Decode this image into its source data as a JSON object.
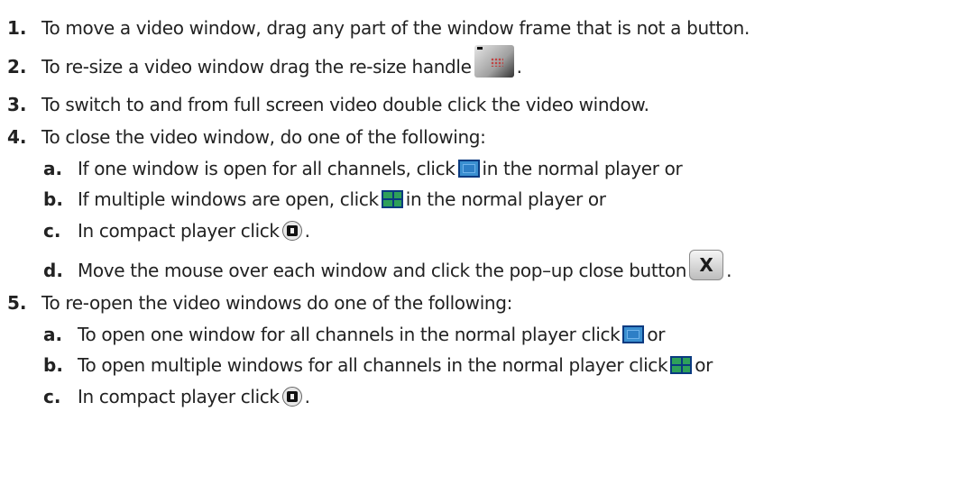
{
  "items": [
    {
      "num": "1.",
      "text": "To move a video window, drag any part of the window frame that is not a button."
    },
    {
      "num": "2.",
      "text": "To re-size a video window drag the re-size handle",
      "after": "."
    },
    {
      "num": "3.",
      "text": "To switch to and from full screen video double click the video window."
    },
    {
      "num": "4.",
      "text": "To close the video window, do one of the following:",
      "sub": [
        {
          "num": "a.",
          "text": "If one window is open for all channels, click",
          "after": "in the normal player or"
        },
        {
          "num": "b.",
          "text": "If multiple windows are open, click",
          "after": "in the normal player or"
        },
        {
          "num": "c.",
          "text": "In compact player click",
          "after": "."
        },
        {
          "num": "d.",
          "text": "Move the mouse over each window and click the pop–up close button",
          "after": "."
        }
      ]
    },
    {
      "num": "5.",
      "text": "To re-open the video windows do one of the following:",
      "sub": [
        {
          "num": "a.",
          "text": "To open one window for all channels in the normal player click",
          "after": "or"
        },
        {
          "num": "b.",
          "text": "To open multiple windows for all channels in the normal player click",
          "after": "or"
        },
        {
          "num": "c.",
          "text": "In compact player click",
          "after": "."
        }
      ]
    }
  ],
  "close_button_glyph": "X",
  "icons": {
    "resize": "resize-handle-icon",
    "single": "single-window-icon",
    "multi": "multiple-windows-icon",
    "film": "compact-player-film-icon",
    "close": "popup-close-button-icon"
  }
}
